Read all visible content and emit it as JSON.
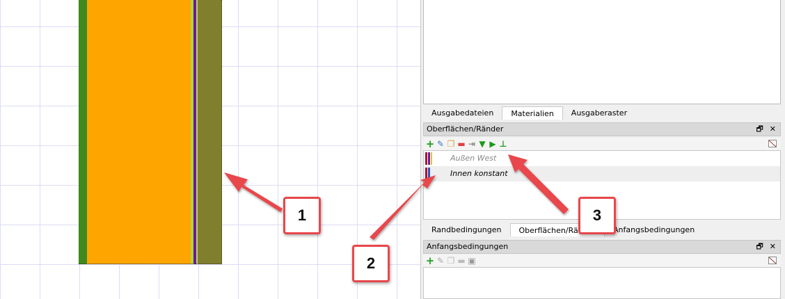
{
  "colors": {
    "layer_green": "#3e8a1c",
    "layer_orange": "#ffa500",
    "layer_yellowgreen": "#b6d43a",
    "layer_purple": "#6a1aa0",
    "layer_olive": "#7f7f2e",
    "callout_red": "#e8474b"
  },
  "top_tabs": [
    "Ausgabedateien",
    "Materialien",
    "Ausgaberaster"
  ],
  "surfaces_dock": {
    "title": "Oberflächen/Ränder",
    "float_icon": "restore-icon",
    "close_label": "✕",
    "toolbar_icons": [
      "add-icon",
      "edit-icon",
      "copy-icon",
      "remove-icon",
      "move-in-icon",
      "move-down-icon",
      "move-right-icon",
      "insert-icon"
    ],
    "items": [
      {
        "label": "Außen West",
        "muted": true
      },
      {
        "label": "Innen konstant",
        "muted": false
      }
    ]
  },
  "bottom_tabs": [
    "Randbedingungen",
    "Oberflächen/Ränder",
    "Anfangsbedingungen"
  ],
  "bottom_tab_partial": "edingungen",
  "initial_dock": {
    "title": "Anfangsbedingungen",
    "close_label": "✕"
  },
  "callouts": [
    "1",
    "2",
    "3"
  ]
}
